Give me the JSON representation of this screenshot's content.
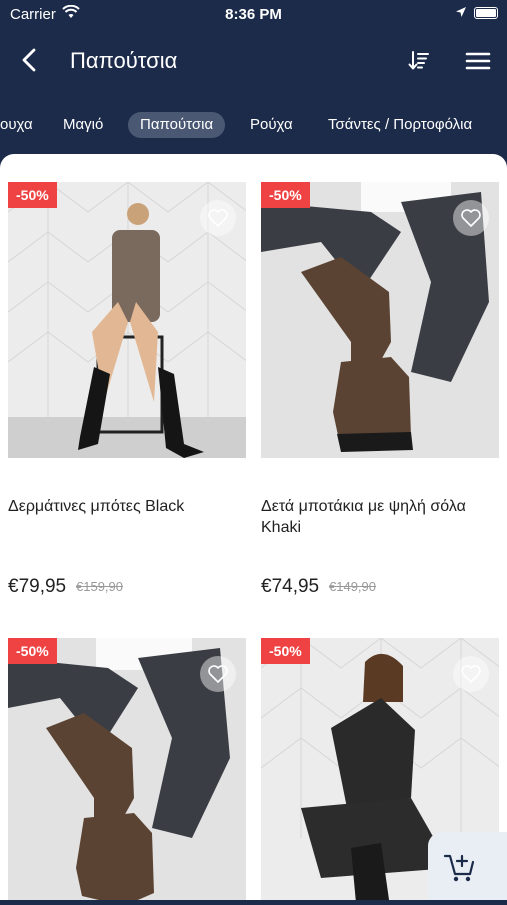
{
  "status_bar": {
    "carrier": "Carrier",
    "time": "8:36 PM"
  },
  "nav": {
    "title": "Παπούτσια"
  },
  "tabs": [
    {
      "label": "ουχα"
    },
    {
      "label": "Μαγιό"
    },
    {
      "label": "Παπούτσια"
    },
    {
      "label": "Ρούχα"
    },
    {
      "label": "Τσάντες / Πορτοφόλια"
    }
  ],
  "products": [
    {
      "badge": "-50%",
      "name": "Δερμάτινες μπότες Black",
      "price": "€79,95",
      "old_price": "€159,90"
    },
    {
      "badge": "-50%",
      "name": "Δετά μποτάκια με ψηλή σόλα Khaki",
      "price": "€74,95",
      "old_price": "€149,90"
    },
    {
      "badge": "-50%",
      "name": "",
      "price": "",
      "old_price": ""
    },
    {
      "badge": "-50%",
      "name": "",
      "price": "",
      "old_price": ""
    }
  ],
  "colors": {
    "header_bg": "#1c2b4a",
    "badge": "#ef4343",
    "tab_active": "#4a5873"
  },
  "icons": [
    "wifi-icon",
    "location-icon",
    "battery-icon",
    "back-chevron-icon",
    "sort-icon",
    "hamburger-menu-icon",
    "heart-icon",
    "add-to-cart-icon"
  ]
}
